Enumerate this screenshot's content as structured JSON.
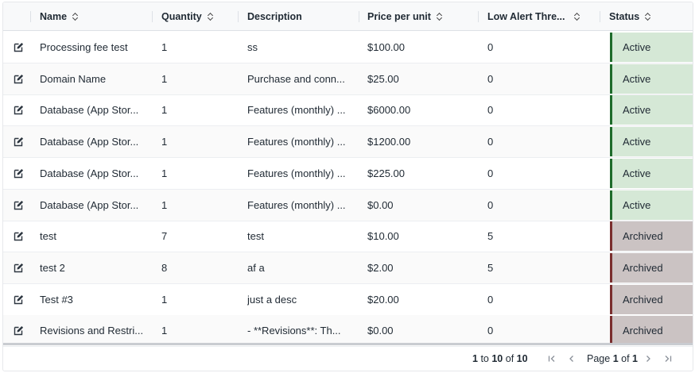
{
  "columns": [
    {
      "label": "Name"
    },
    {
      "label": "Quantity"
    },
    {
      "label": "Description"
    },
    {
      "label": "Price per unit"
    },
    {
      "label": "Low Alert Thre..."
    },
    {
      "label": "Status"
    }
  ],
  "rows": [
    {
      "name": "Processing fee test",
      "quantity": "1",
      "description": "ss",
      "price": "$100.00",
      "low_alert": "0",
      "status": "Active"
    },
    {
      "name": "Domain Name",
      "quantity": "1",
      "description": "Purchase and conn...",
      "price": "$25.00",
      "low_alert": "0",
      "status": "Active"
    },
    {
      "name": "Database (App Stor...",
      "quantity": "1",
      "description": "Features (monthly) ...",
      "price": "$6000.00",
      "low_alert": "0",
      "status": "Active"
    },
    {
      "name": "Database (App Stor...",
      "quantity": "1",
      "description": "Features (monthly) ...",
      "price": "$1200.00",
      "low_alert": "0",
      "status": "Active"
    },
    {
      "name": "Database (App Stor...",
      "quantity": "1",
      "description": "Features (monthly) ...",
      "price": "$225.00",
      "low_alert": "0",
      "status": "Active"
    },
    {
      "name": "Database (App Stor...",
      "quantity": "1",
      "description": "Features (monthly) ...",
      "price": "$0.00",
      "low_alert": "0",
      "status": "Active"
    },
    {
      "name": "test",
      "quantity": "7",
      "description": "test",
      "price": "$10.00",
      "low_alert": "5",
      "status": "Archived"
    },
    {
      "name": "test 2",
      "quantity": "8",
      "description": "af a",
      "price": "$2.00",
      "low_alert": "5",
      "status": "Archived"
    },
    {
      "name": "Test #3",
      "quantity": "1",
      "description": "just a desc",
      "price": "$20.00",
      "low_alert": "0",
      "status": "Archived"
    },
    {
      "name": "Revisions and Restri...",
      "quantity": "1",
      "description": "- **Revisions**: Th...",
      "price": "$0.00",
      "low_alert": "0",
      "status": "Archived"
    }
  ],
  "status_colors": {
    "Active": "#d5e8d6",
    "Archived": "#cbc3c3"
  },
  "icons": {
    "edit": "edit-icon",
    "sort": "sort-icon"
  },
  "pagination": {
    "range_start": "1",
    "range_to": "to",
    "range_end": "10",
    "range_of": "of",
    "total": "10",
    "page_label": "Page",
    "current_page": "1",
    "page_of": "of",
    "total_pages": "1"
  }
}
